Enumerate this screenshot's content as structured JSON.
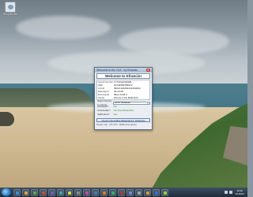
{
  "desktop": {
    "icon_label": "Recycle Bin"
  },
  "dialog": {
    "title": "Welcome to the GUI - by Kfrancis",
    "close_glyph": "✕",
    "welcome_text": "Welcome to Kfrancis!",
    "info": [
      {
        "label": "Serial Number",
        "value": "C7XFNHV9DF8L"
      },
      {
        "label": "IMEI",
        "value": "01234560789012"
      },
      {
        "label": "ICCID",
        "value": "89014104254321000000"
      },
      {
        "label": "Baseband",
        "value": "05.26.08"
      },
      {
        "label": "Bootloader",
        "value": "iBoot-1145.3"
      },
      {
        "label": "Model",
        "value": "iPhone 3 GS 8GB 3GS"
      }
    ],
    "select_label": "Select Device to Carrier",
    "select_value": "AT&T Wireless",
    "activated_label": "Activated?",
    "activated_value": "Yes",
    "unlockable_label": "Unlockable?",
    "unlockable_value": "Yes (via Ultrasn0w)",
    "jailbroken_label": "Jailbroken?",
    "jailbroken_value": "Yes",
    "check_button": "Check Unlockable Baseband in Database",
    "footer": "Ready. Idle - 0% CPU, 0MB/s throughput"
  },
  "taskbar": {
    "clock_time": "12:00",
    "clock_date": "1/1/2011",
    "task_colors": [
      "#3b8fd6",
      "#e2a33a",
      "#5aa84c",
      "#c94a3a",
      "#7b5cc4",
      "#3aa8a8",
      "#d6d63b",
      "#8a8a8a",
      "#c44ab4",
      "#4a78c4",
      "#e07a2a",
      "#3bb06b",
      "#b03b3b",
      "#6e8ad6",
      "#a0a0a0",
      "#d6983b",
      "#3b6ed6",
      "#8ad63b"
    ]
  }
}
